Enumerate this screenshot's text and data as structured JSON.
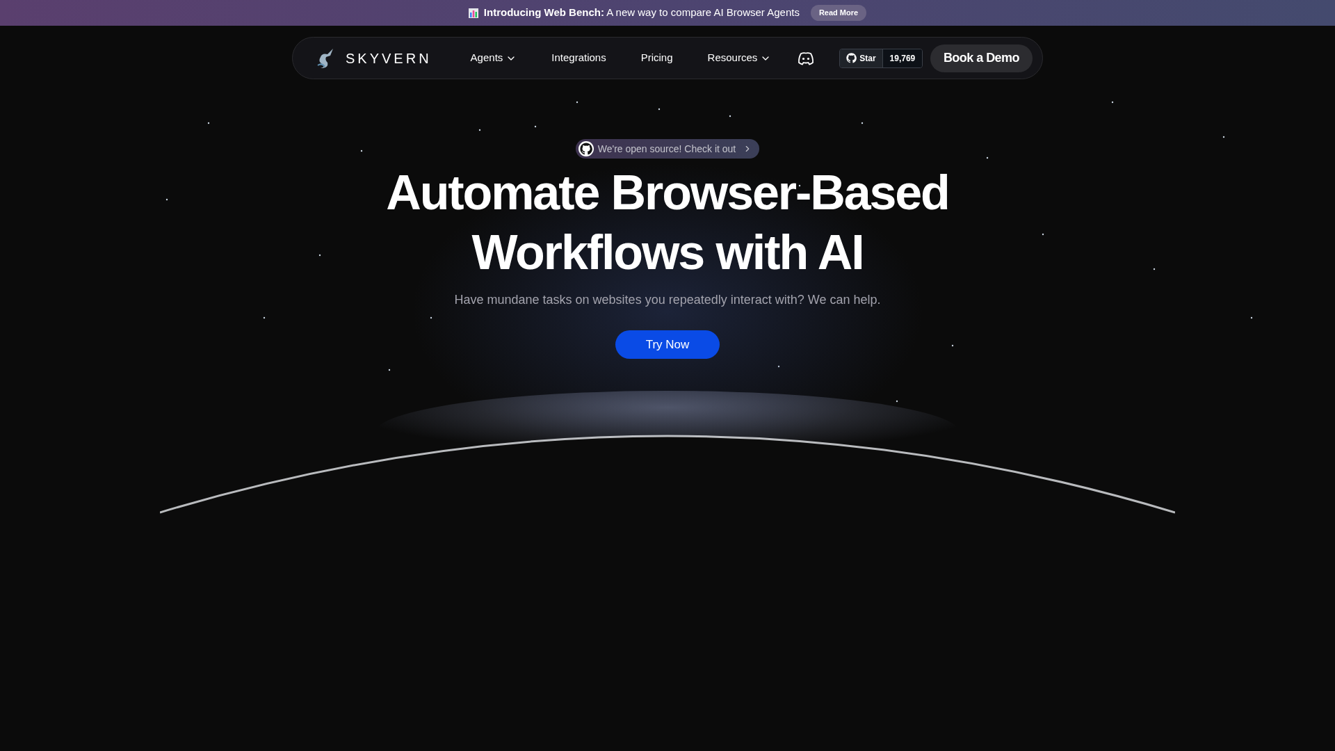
{
  "banner": {
    "text": "**Introducing Web Bench:** A new way to compare AI Browser Agents",
    "button": "Read More"
  },
  "nav": {
    "brand": "SKYVERN",
    "items": [
      {
        "label": "Agents",
        "kind": "dropdown"
      },
      {
        "label": "Integrations",
        "kind": "link"
      },
      {
        "label": "Pricing",
        "kind": "link"
      },
      {
        "label": "Resources",
        "kind": "dropdown"
      }
    ],
    "github": {
      "label": "Star",
      "count": "19,769"
    },
    "cta": "Book a Demo"
  },
  "hero": {
    "badge": "We're open source! Check it out",
    "title_lines": [
      "Automate Browser-Based",
      "Workflows with AI"
    ],
    "subtitle": "Have mundane tasks on websites you repeatedly interact with? We can help.",
    "button": "Try Now"
  }
}
